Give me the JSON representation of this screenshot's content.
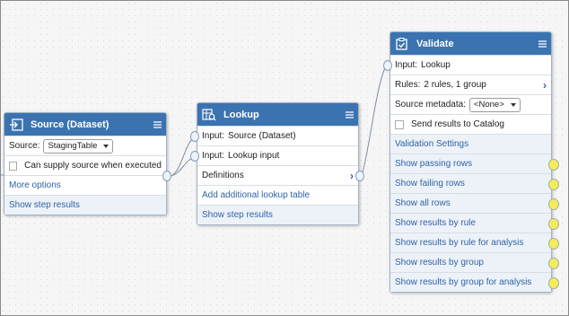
{
  "source_node": {
    "title": "Source (Dataset)",
    "icon": "import-icon",
    "source_label": "Source:",
    "source_value": "StagingTable",
    "checkbox_label": "Can supply source when executed",
    "checkbox_checked": false,
    "more_options": "More options",
    "show_step_results": "Show step results"
  },
  "lookup_node": {
    "title": "Lookup",
    "icon": "table-search-icon",
    "input1": {
      "label": "Input:",
      "value": "Source (Dataset)"
    },
    "input2": {
      "label": "Input:",
      "value": "Lookup input"
    },
    "definitions": "Definitions",
    "add_lookup_table": "Add additional lookup table",
    "show_step_results": "Show step results"
  },
  "validate_node": {
    "title": "Validate",
    "icon": "checklist-icon",
    "input": {
      "label": "Input:",
      "value": "Lookup"
    },
    "rules": {
      "label": "Rules:",
      "value": "2 rules, 1 group"
    },
    "source_metadata": {
      "label": "Source metadata:",
      "value": "<None>"
    },
    "send_results_label": "Send results to Catalog",
    "send_results_checked": false,
    "validation_settings": "Validation Settings",
    "outputs": [
      "Show passing rows",
      "Show failing rows",
      "Show all rows",
      "Show results by rule",
      "Show results by rule for analysis",
      "Show results by group",
      "Show results by group for analysis"
    ]
  },
  "colors": {
    "header": "#3b73b0",
    "link": "#2e63a6",
    "link_row_bg": "#edf2f8",
    "output_port": "#f2ee5a"
  }
}
